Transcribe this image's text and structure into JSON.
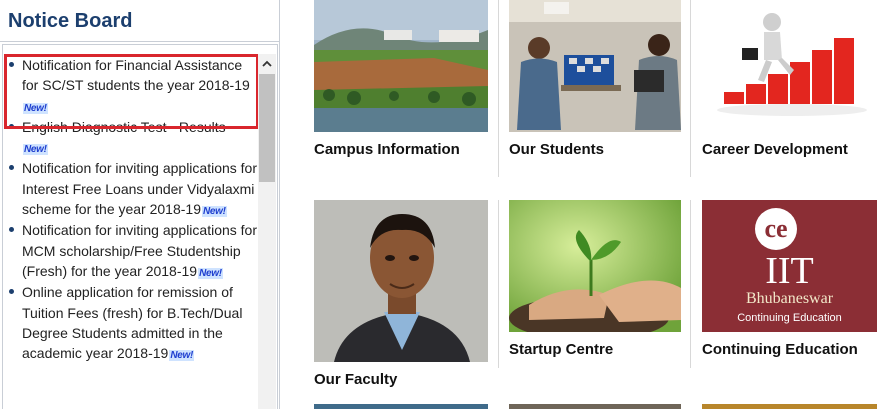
{
  "notice_board": {
    "title": "Notice Board",
    "new_label": "New!",
    "items": [
      {
        "text": "Notification for Financial Assistance for SC/ST students the year 2018-19",
        "highlighted": true
      },
      {
        "text": "English Diagnostic Test - Results"
      },
      {
        "text": "Notification for inviting applications for Interest Free Loans under Vidyalaxmi scheme for the year 2018-19"
      },
      {
        "text": "Notification for inviting applications for MCM scholarship/Free Studentship (Fresh) for the year 2018-19"
      },
      {
        "text": "Online application for remission of Tuition Fees (fresh) for B.Tech/Dual Degree Students admitted in the academic year 2018-19"
      }
    ]
  },
  "tiles": [
    {
      "label": "Campus Information"
    },
    {
      "label": "Our Students"
    },
    {
      "label": "Career Development"
    },
    {
      "label": "Our Faculty"
    },
    {
      "label": "Startup Centre"
    },
    {
      "label": "Continuing Education"
    }
  ],
  "ce_logo": {
    "mark": "ce",
    "line1": "IIT",
    "line2": "Bhubaneswar",
    "line3": "Continuing Education"
  },
  "colors": {
    "notice_title": "#1c3f6e",
    "highlight": "#d9262d",
    "ce_bg": "#8b2e35"
  }
}
